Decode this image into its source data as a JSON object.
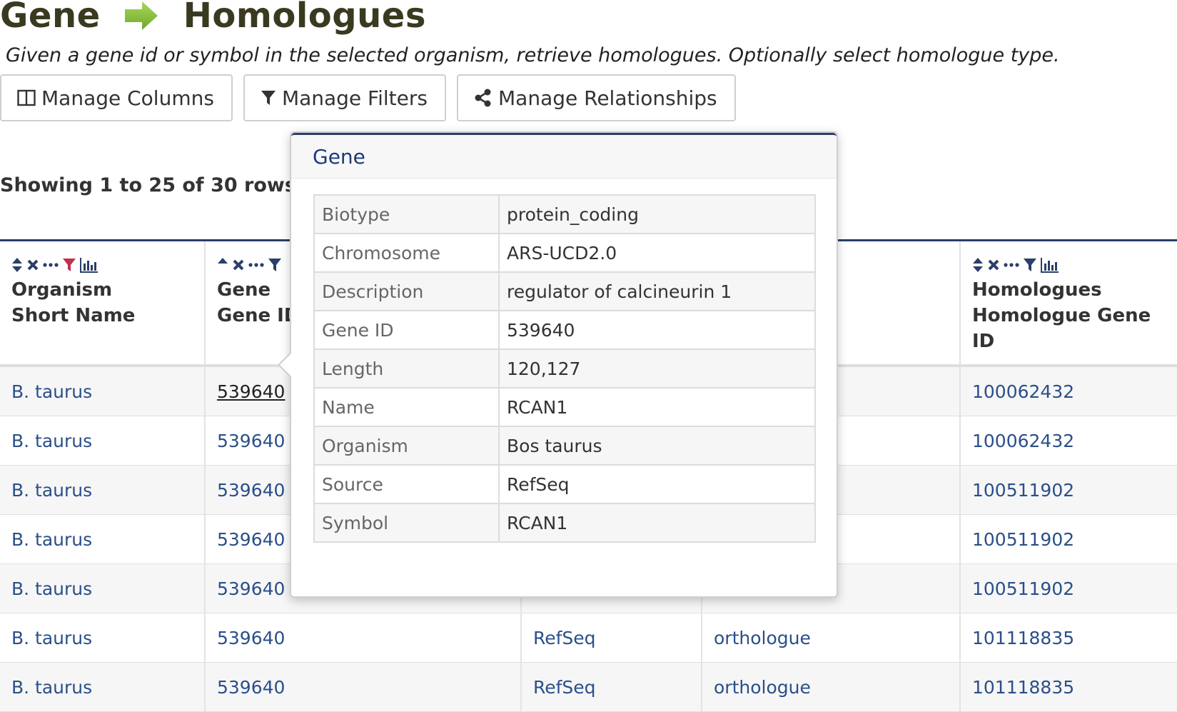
{
  "header": {
    "title_left": "Gene",
    "title_right": "Homologues",
    "description": "Given a gene id or symbol in the selected organism, retrieve homologues. Optionally select homologue type."
  },
  "toolbar": {
    "manage_columns": "Manage Columns",
    "manage_filters": "Manage Filters",
    "manage_relationships": "Manage Relationships"
  },
  "row_count": "Showing 1 to 25 of 30 rows",
  "table": {
    "headers": [
      {
        "line1": "Organism",
        "line2": "Short Name"
      },
      {
        "line1": "Gene",
        "line2": "Gene ID"
      },
      {
        "line1": "",
        "line2": ""
      },
      {
        "line1": "",
        "line2": ""
      },
      {
        "line1": "Homologues",
        "line2": "Homologue Gene ID"
      }
    ],
    "rows": [
      [
        "B. taurus",
        "539640",
        "",
        "",
        "100062432"
      ],
      [
        "B. taurus",
        "539640",
        "",
        "",
        "100062432"
      ],
      [
        "B. taurus",
        "539640",
        "",
        "",
        "100511902"
      ],
      [
        "B. taurus",
        "539640",
        "",
        "",
        "100511902"
      ],
      [
        "B. taurus",
        "539640",
        "",
        "",
        "100511902"
      ],
      [
        "B. taurus",
        "539640",
        "RefSeq",
        "orthologue",
        "101118835"
      ],
      [
        "B. taurus",
        "539640",
        "RefSeq",
        "orthologue",
        "101118835"
      ]
    ]
  },
  "popover": {
    "title": "Gene",
    "fields": [
      {
        "key": "Biotype",
        "value": "protein_coding"
      },
      {
        "key": "Chromosome",
        "value": "ARS-UCD2.0"
      },
      {
        "key": "Description",
        "value": "regulator of calcineurin 1"
      },
      {
        "key": "Gene ID",
        "value": "539640"
      },
      {
        "key": "Length",
        "value": "120,127"
      },
      {
        "key": "Name",
        "value": "RCAN1"
      },
      {
        "key": "Organism",
        "value": "Bos taurus"
      },
      {
        "key": "Source",
        "value": "RefSeq"
      },
      {
        "key": "Symbol",
        "value": "RCAN1"
      }
    ]
  },
  "colors": {
    "accent_navy": "#2a3f6a",
    "link": "#2a4f8a",
    "arrow_green": "#8cc63f",
    "filter_active": "#c0304a"
  }
}
